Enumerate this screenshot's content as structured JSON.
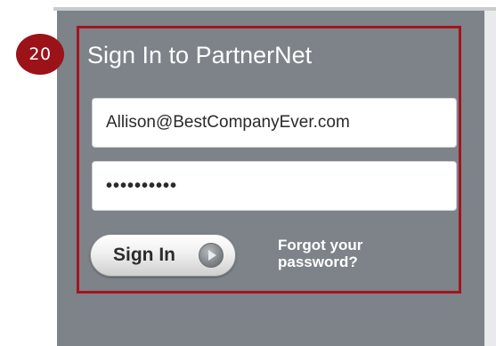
{
  "step_badge": "20",
  "signin": {
    "title": "Sign In to PartnerNet",
    "email_value": "Allison@BestCompanyEver.com",
    "password_mask": "••••••••••",
    "button_label": "Sign In",
    "forgot_line1": "Forgot your",
    "forgot_line2": "password?"
  },
  "colors": {
    "panel_bg": "#7d8389",
    "highlight_border": "#a31420",
    "badge_bg": "#9b1218",
    "text_light": "#ffffff"
  },
  "icons": {
    "signin_arrow": "play-arrow-icon"
  }
}
